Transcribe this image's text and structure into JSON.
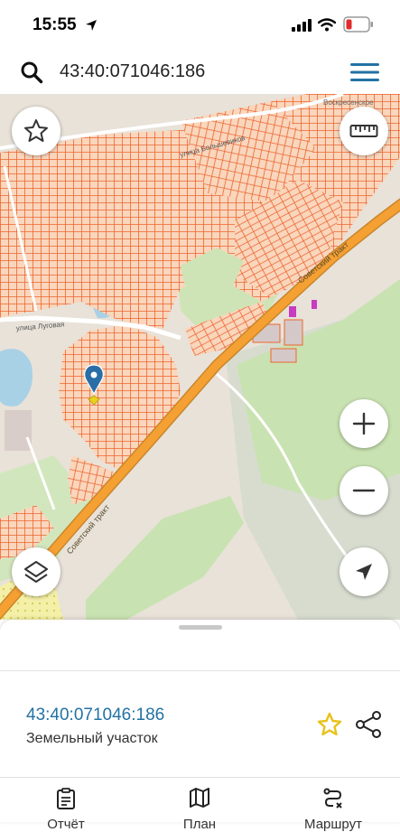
{
  "status_bar": {
    "time": "15:55"
  },
  "search": {
    "query": "43:40:071046:186"
  },
  "map": {
    "labels": {
      "settlement": "Воскресенское",
      "road_top": "Советский тракт",
      "road_bottom": "Советский тракт",
      "street": "улица Большевиков",
      "street2": "улица Луговая"
    }
  },
  "sheet": {
    "cadastral_number": "43:40:071046:186",
    "property_type": "Земельный участок"
  },
  "tabs": [
    {
      "label": "Отчёт",
      "icon": "report-icon"
    },
    {
      "label": "План",
      "icon": "map-icon"
    },
    {
      "label": "Маршрут",
      "icon": "route-icon"
    }
  ],
  "colors": {
    "parcel_stroke": "#ef6a34",
    "parcel_fill": "#fbe3cf",
    "road": "#f5a033",
    "green": "#cfe4b6",
    "water": "#a9d1e6",
    "link": "#2372a3",
    "favorite_star": "#e7c21c"
  }
}
